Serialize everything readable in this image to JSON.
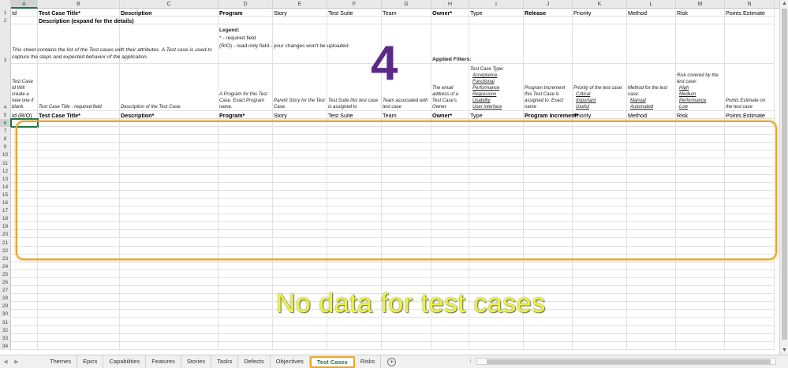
{
  "columns": [
    "A",
    "B",
    "C",
    "D",
    "E",
    "F",
    "G",
    "H",
    "I",
    "J",
    "K",
    "L",
    "M",
    "N"
  ],
  "row1": [
    "Id",
    "Test Case Title*",
    "Description",
    "Program",
    "Story",
    "Test Suite",
    "Team",
    "Owner*",
    "Type",
    "Release",
    "Priority",
    "Method",
    "Risk",
    "Points Estimate"
  ],
  "row2_b": "Description (expand for the details)",
  "row3": {
    "a": "This sheet contains the list of the Test cases with their attributes. A Test case is used to capture the steps and expected behavior of the application.",
    "legend_title": "Legend:",
    "legend_1": "* - required field",
    "legend_2": "(R/O) - read only field  - your changes won't be uploaded",
    "filters": "Applied Filters:"
  },
  "row4": {
    "a": "Test Case Id Will create a new one if blank.",
    "b": "Test Case Title - required field",
    "c": "Description of the Test Case.",
    "d": "A Program for this Test Case. Exact Program name.",
    "e": "Parent Story for the Test Case.",
    "f": "Test Suite this test case is assigned to",
    "g": "Team associated with test case",
    "h": "The email address of a Test Case's Owner.",
    "i_title": "Test Case Type:",
    "i_opts": [
      "Acceptance",
      "Functional",
      "Performance",
      "Regression",
      "Usability",
      "User interface"
    ],
    "j": "Program Increment this Test Case is assigned to. Exact name",
    "k_title": "Priority of the test case:",
    "k_opts": [
      "Critical",
      "Important",
      "Useful"
    ],
    "l_title": "Method for the test case:",
    "l_opts": [
      "Manual",
      "Automated"
    ],
    "m_title": "Risk covered by the test case:",
    "m_opts": [
      "High",
      "Medium",
      "Performance",
      "Low"
    ],
    "n": "Points Estimate on the test case"
  },
  "row5": [
    "Id (R/O)",
    "Test Case Title*",
    "Description*",
    "Program*",
    "Story",
    "Test Suite",
    "Team",
    "Owner*",
    "Type",
    "Program Increment*",
    "Priority",
    "Method",
    "Risk",
    "Points Estimate"
  ],
  "row_numbers": [
    "1",
    "2",
    "3",
    "4",
    "5",
    "6",
    "7",
    "8",
    "9",
    "10",
    "11",
    "12",
    "13",
    "14",
    "15",
    "16",
    "17",
    "18",
    "19",
    "20",
    "21",
    "22",
    "23",
    "24",
    "25",
    "26",
    "27",
    "28",
    "29",
    "30",
    "31",
    "32",
    "33",
    "34"
  ],
  "tabs": [
    "Themes",
    "Epics",
    "Capabilities",
    "Features",
    "Stories",
    "Tasks",
    "Defects",
    "Objectives",
    "Test Cases",
    "Risks"
  ],
  "active_tab": "Test Cases",
  "overlay_number": "4",
  "overlay_caption": "No data for test cases",
  "colors": {
    "highlight": "#e8a52a",
    "number": "#5b2a86",
    "caption": "#e8f24b",
    "excel_green": "#217346"
  }
}
